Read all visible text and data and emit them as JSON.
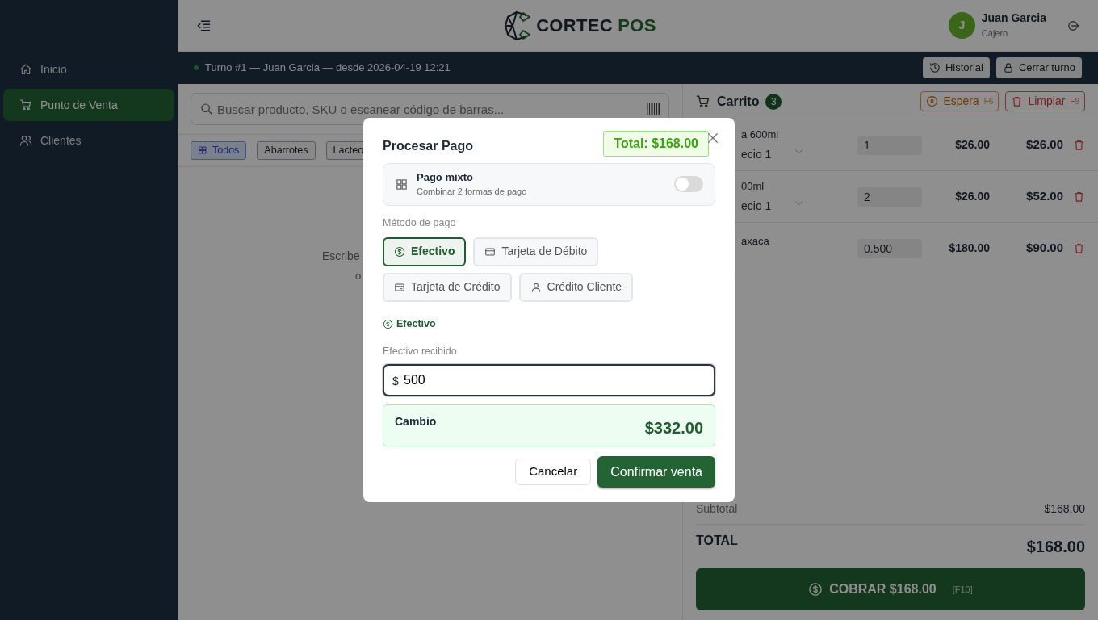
{
  "sidebar": {
    "items": [
      {
        "label": "Inicio",
        "selected": false
      },
      {
        "label": "Punto de Venta",
        "selected": true
      },
      {
        "label": "Clientes",
        "selected": false
      }
    ]
  },
  "header": {
    "brand": "CORTEC",
    "brand_suffix": "POS",
    "user": {
      "initial": "J",
      "name": "Juan Garcia",
      "role": "Cajero"
    }
  },
  "shift_bar": {
    "text": "Turno #1 — Juan Garcia — desde 2026-04-19 12:21",
    "buttons": [
      "Historial",
      "Cerrar turno"
    ]
  },
  "search": {
    "placeholder": "Buscar producto, SKU o escanear código de barras..."
  },
  "categories": [
    {
      "label": "Todos",
      "selected": true
    },
    {
      "label": "Abarrotes",
      "selected": false
    },
    {
      "label": "Lacteo",
      "selected": false
    }
  ],
  "empty_state": [
    "Escribe",
    "o"
  ],
  "cart": {
    "title": "Carrito",
    "count": "3",
    "actions": [
      {
        "label": "Espera",
        "key": "F6",
        "kind": "hold"
      },
      {
        "label": "Limpiar",
        "key": "F9",
        "kind": "clear"
      }
    ],
    "items": [
      {
        "name": "a 600ml",
        "price_level": "ecio 1",
        "quantity": "1",
        "unit_price": "$26.00",
        "total": "$26.00"
      },
      {
        "name": "00ml",
        "price_level": "ecio 1",
        "quantity": "2",
        "unit_price": "$26.00",
        "total": "$52.00"
      },
      {
        "name": "axaca",
        "quantity": "0.500",
        "unit_price": "$180.00",
        "total": "$90.00"
      }
    ],
    "subtotal_label": "Subtotal",
    "subtotal": "$168.00",
    "total_label": "TOTAL",
    "total": "$168.00",
    "charge_button": {
      "label": "COBRAR $168.00",
      "key": "[F10]"
    }
  },
  "dialog": {
    "title": "Procesar Pago",
    "total": "Total: $168.00",
    "mixed": {
      "title": "Pago mixto",
      "subtitle": "Combinar 2 formas de pago",
      "on": false
    },
    "method_label": "Método de pago",
    "methods": [
      {
        "label": "Efectivo",
        "selected": true
      },
      {
        "label": "Tarjeta de Débito",
        "selected": false
      },
      {
        "label": "Tarjeta de Crédito",
        "selected": false
      },
      {
        "label": "Crédito Cliente",
        "selected": false
      }
    ],
    "selected_method": "Efectivo",
    "cash_label": "Efectivo recibido",
    "cash_prefix": "$",
    "cash_value": "500",
    "change_label": "Cambio",
    "change": "$332.00",
    "buttons": [
      {
        "label": "Cancelar",
        "kind": "secondary"
      },
      {
        "label": "Confirmar venta",
        "kind": "primary"
      }
    ]
  }
}
